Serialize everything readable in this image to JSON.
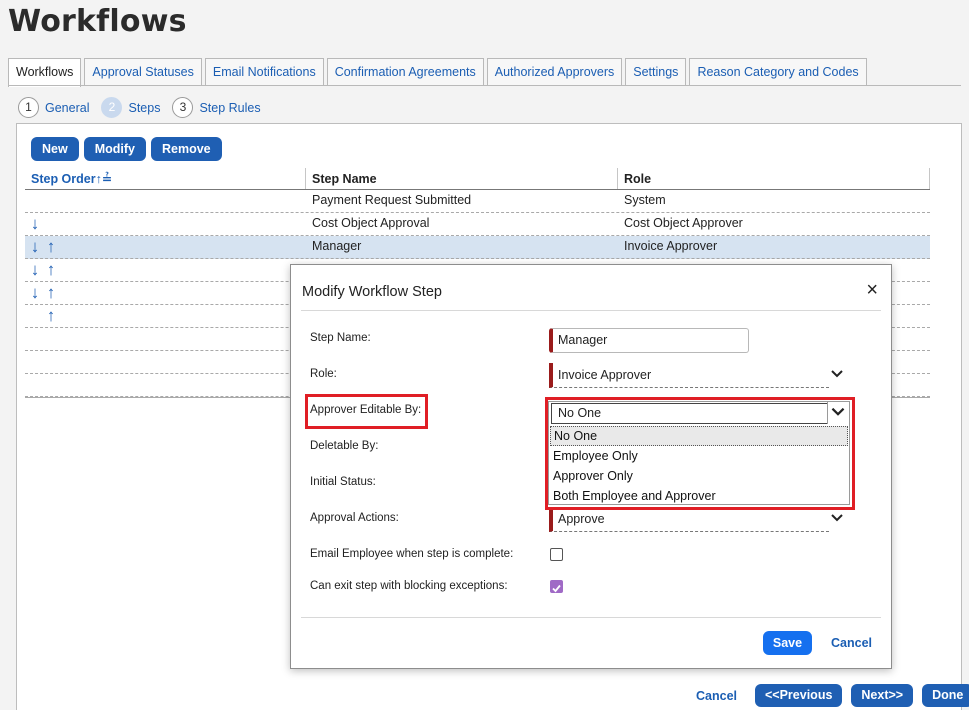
{
  "page": {
    "title": "Workflows"
  },
  "tabs": [
    {
      "label": "Workflows",
      "active": true
    },
    {
      "label": "Approval Statuses",
      "active": false
    },
    {
      "label": "Email Notifications",
      "active": false
    },
    {
      "label": "Confirmation Agreements",
      "active": false
    },
    {
      "label": "Authorized Approvers",
      "active": false
    },
    {
      "label": "Settings",
      "active": false
    },
    {
      "label": "Reason Category and Codes",
      "active": false
    }
  ],
  "wizard_steps": [
    {
      "number": "1",
      "label": "General",
      "current": false
    },
    {
      "number": "2",
      "label": "Steps",
      "current": true
    },
    {
      "number": "3",
      "label": "Step Rules",
      "current": false
    }
  ],
  "toolbar": {
    "new_label": "New",
    "modify_label": "Modify",
    "remove_label": "Remove"
  },
  "grid": {
    "headers": {
      "order": "Step Order",
      "order_sort_icon": "↑≟",
      "name": "Step Name",
      "role": "Role"
    },
    "rows": [
      {
        "arrows": "",
        "name": "Payment Request Submitted",
        "role": "System"
      },
      {
        "arrows": "↓",
        "name": "Cost Object Approval",
        "role": "Cost Object Approver"
      },
      {
        "arrows": "↓↑",
        "name": "Manager",
        "role": "Invoice Approver",
        "selected": true
      },
      {
        "arrows": "↓↑",
        "name": "",
        "role": ""
      },
      {
        "arrows": "↓↑",
        "name": "",
        "role": ""
      },
      {
        "arrows": " ↑",
        "name": "",
        "role": ""
      },
      {
        "arrows": "",
        "name": "",
        "role": ""
      },
      {
        "arrows": "",
        "name": "",
        "role": ""
      },
      {
        "arrows": "",
        "name": "",
        "role": ""
      }
    ]
  },
  "footer": {
    "cancel_label": "Cancel",
    "previous_label": "<<Previous",
    "next_label": "Next>>",
    "done_label": "Done"
  },
  "modal": {
    "title": "Modify Workflow Step",
    "close_icon": "×",
    "fields": {
      "step_name": {
        "label": "Step Name:",
        "value": "Manager"
      },
      "role": {
        "label": "Role:",
        "value": "Invoice Approver"
      },
      "approver_editable_by": {
        "label": "Approver Editable By:",
        "value": "No One"
      },
      "deletable_by": {
        "label": "Deletable By:"
      },
      "initial_status": {
        "label": "Initial Status:"
      },
      "approval_actions": {
        "label": "Approval Actions:",
        "value": "Approve"
      },
      "email_employee": {
        "label": "Email Employee when step is complete:",
        "checked": false
      },
      "can_exit_step": {
        "label": "Can exit step with blocking exceptions:",
        "checked": true
      }
    },
    "dropdown_options": [
      "No One",
      "Employee Only",
      "Approver Only",
      "Both Employee and Approver"
    ],
    "dropdown_selected": "No One",
    "save_label": "Save",
    "cancel_label": "Cancel"
  },
  "colors": {
    "accent": "#1f5fb3",
    "required_marker": "#9a1b1b",
    "highlight": "#e01e25",
    "checkbox_checked": "#a06ac6"
  }
}
